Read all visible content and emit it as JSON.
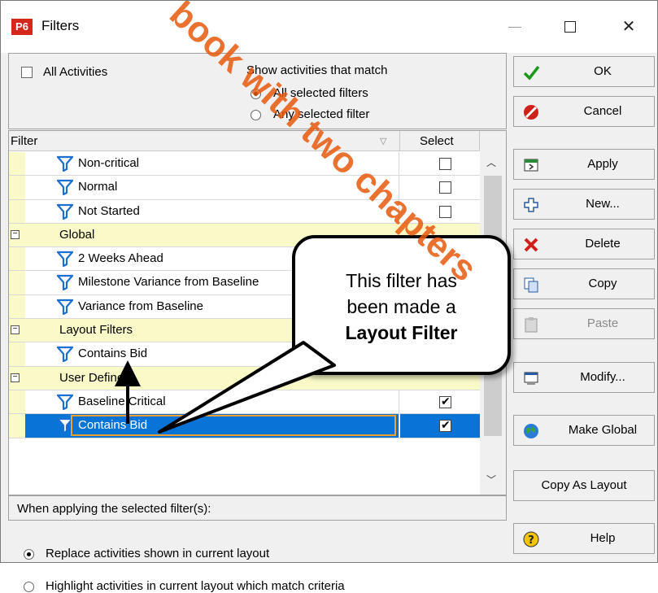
{
  "window": {
    "app_badge": "P6",
    "title": "Filters",
    "close_glyph": "✕"
  },
  "options": {
    "all_activities_label": "All Activities",
    "show_match_label": "Show activities that match",
    "radio_all": "All selected filters",
    "radio_any": "Any selected filter"
  },
  "table": {
    "col_filter": "Filter",
    "col_select": "Select",
    "rows": [
      {
        "type": "filter",
        "name": "Non-critical",
        "checked": false
      },
      {
        "type": "filter",
        "name": "Normal",
        "checked": false
      },
      {
        "type": "filter",
        "name": "Not Started",
        "checked": false
      },
      {
        "type": "group",
        "name": "Global"
      },
      {
        "type": "filter",
        "name": "2 Weeks Ahead",
        "checked": false
      },
      {
        "type": "filter",
        "name": "Milestone Variance from Baseline",
        "checked": false
      },
      {
        "type": "filter",
        "name": "Variance from Baseline",
        "checked": false
      },
      {
        "type": "group",
        "name": "Layout Filters"
      },
      {
        "type": "filter",
        "name": "Contains Bid",
        "checked": false
      },
      {
        "type": "group",
        "name": "User Defined"
      },
      {
        "type": "filter",
        "name": "Baseline Critical",
        "checked": true
      },
      {
        "type": "filter",
        "name": "Contains Bid",
        "checked": true,
        "selected": true
      }
    ]
  },
  "apply_section": {
    "header": "When applying the selected filter(s):",
    "radio_replace": "Replace activities shown in current layout",
    "radio_highlight": "Highlight activities in current layout which match criteria"
  },
  "buttons": {
    "ok": "OK",
    "cancel": "Cancel",
    "apply": "Apply",
    "new": "New...",
    "delete": "Delete",
    "copy": "Copy",
    "paste": "Paste",
    "modify": "Modify...",
    "make_global": "Make Global",
    "copy_as_layout": "Copy As Layout",
    "help": "Help"
  },
  "callout": {
    "line1": "This filter has",
    "line2": "been made a",
    "line3": "Layout Filter"
  },
  "watermark": {
    "text": "book with two chapters",
    "color": "#e8580c"
  },
  "colors": {
    "selection": "#0a74d6",
    "group_bg": "#fafac8",
    "funnel": "#1a6fd0"
  }
}
